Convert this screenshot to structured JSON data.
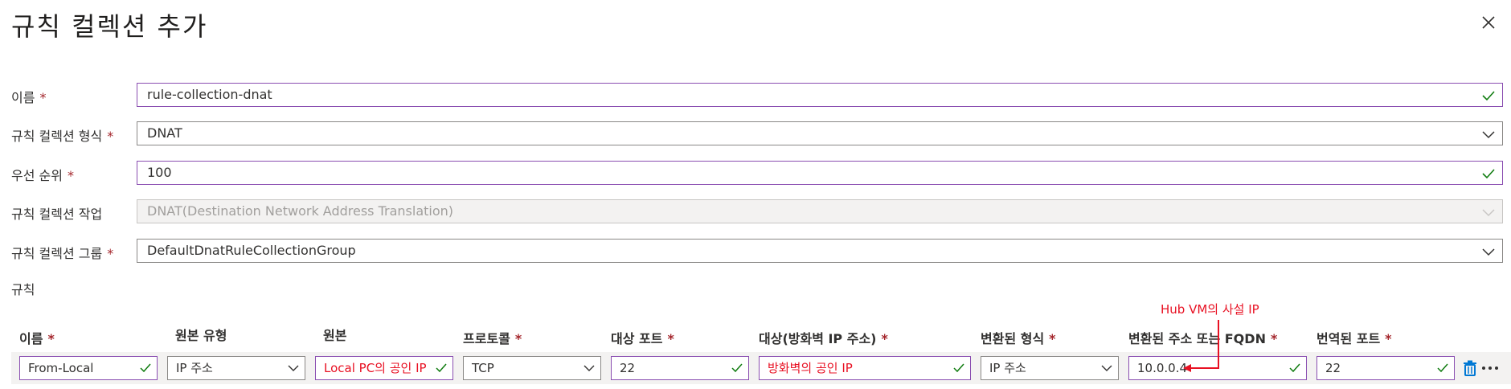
{
  "dialog": {
    "title": "규칙 컬렉션 추가",
    "close_icon": "close-icon"
  },
  "form": {
    "required_marker": "*",
    "name": {
      "label": "이름",
      "value": "rule-collection-dnat"
    },
    "type": {
      "label": "규칙 컬렉션 형식",
      "value": "DNAT"
    },
    "priority": {
      "label": "우선 순위",
      "value": "100"
    },
    "action": {
      "label": "규칙 컬렉션 작업",
      "value": "DNAT(Destination Network Address Translation)"
    },
    "group": {
      "label": "규칙 컬렉션 그룹",
      "value": "DefaultDnatRuleCollectionGroup"
    },
    "rules_label": "규칙"
  },
  "rules": {
    "headers": [
      {
        "text": "이름",
        "required": true
      },
      {
        "text": "원본 유형",
        "required": false
      },
      {
        "text": "원본",
        "required": false
      },
      {
        "text": "프로토콜",
        "required": true
      },
      {
        "text": "대상 포트",
        "required": true
      },
      {
        "text": "대상(방화벽 IP 주소)",
        "required": true
      },
      {
        "text": "변환된 형식",
        "required": true
      },
      {
        "text": "변환된 주소 또는 FQDN",
        "required": true
      },
      {
        "text": "번역된 포트",
        "required": true
      }
    ],
    "row": {
      "name": "From-Local",
      "source_type": "IP 주소",
      "source": "Local PC의 공인 IP",
      "protocol": "TCP",
      "dest_port": "22",
      "destination": "방화벽의 공인 IP",
      "translated_type": "IP 주소",
      "translated_address": "10.0.0.4",
      "translated_port": "22"
    }
  },
  "annotation": {
    "text": "Hub VM의 사설 IP",
    "color": "#e81123"
  },
  "colors": {
    "valid_border": "#8a4eb1",
    "check": "#107c10",
    "required": "#a4262c",
    "delete": "#0078d4"
  }
}
